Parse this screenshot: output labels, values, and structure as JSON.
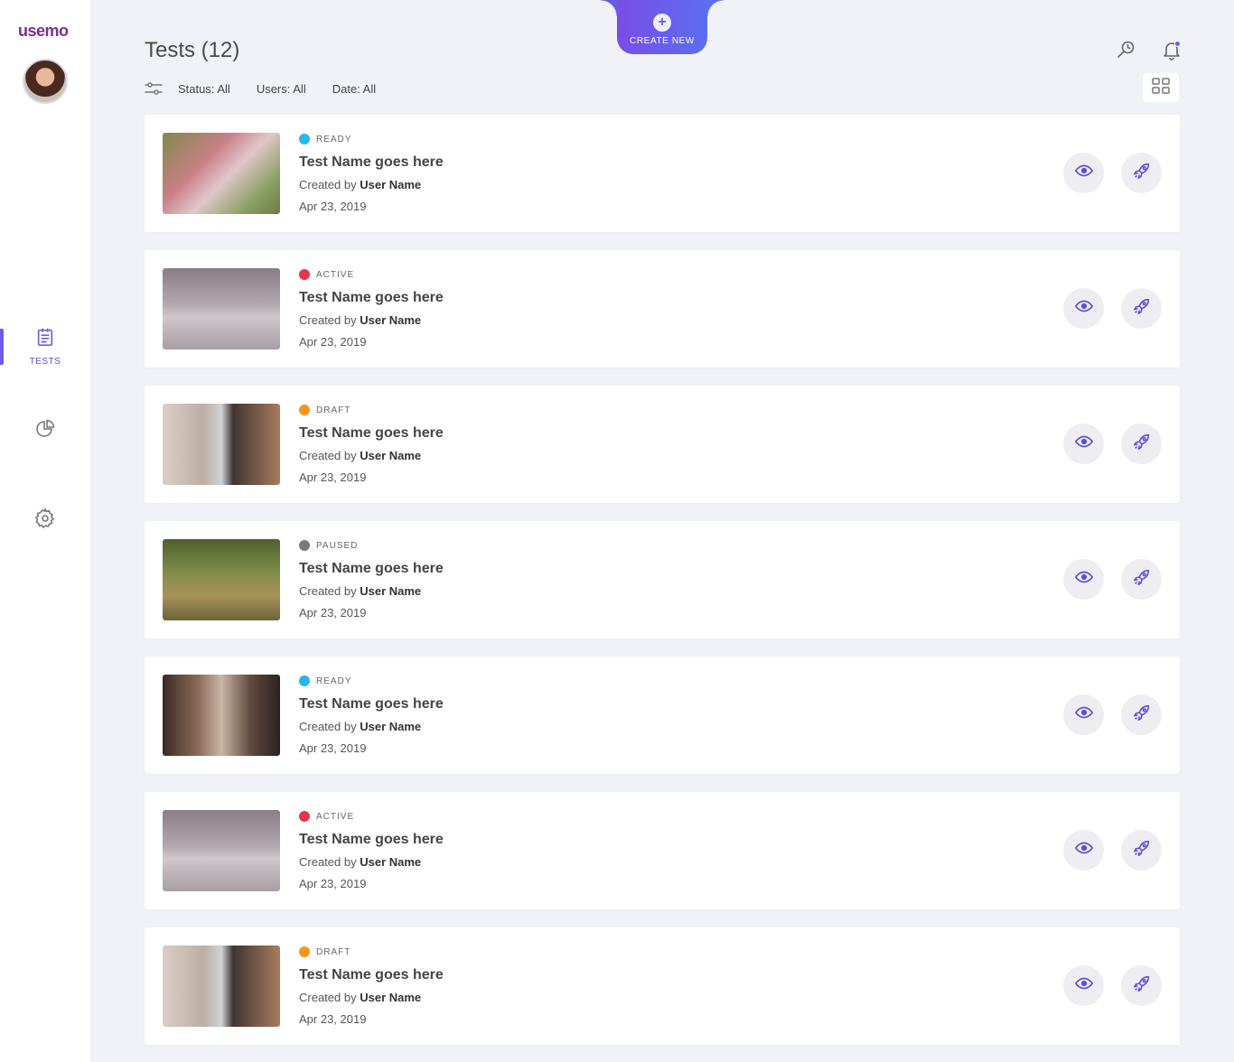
{
  "app": {
    "logo": "usemo"
  },
  "sidebar": {
    "items": [
      {
        "label": "TESTS",
        "icon": "clipboard-icon",
        "active": true
      },
      {
        "label": "",
        "icon": "pie-chart-icon",
        "active": false
      },
      {
        "label": "",
        "icon": "gear-icon",
        "active": false
      }
    ]
  },
  "header": {
    "title": "Tests (12)",
    "create_label": "CREATE NEW"
  },
  "filters": {
    "status": "Status: All",
    "users": "Users: All",
    "date": "Date: All"
  },
  "colors": {
    "accent": "#6c5ce7",
    "ready": "#29b6e8",
    "active": "#e8344e",
    "draft": "#f7941d",
    "paused": "#7a7a7a"
  },
  "tests": [
    {
      "status": "READY",
      "name": "Test Name goes here",
      "created_prefix": "Created by",
      "user": "User Name",
      "date": "Apr 23, 2019"
    },
    {
      "status": "ACTIVE",
      "name": "Test Name goes here",
      "created_prefix": "Created by",
      "user": "User Name",
      "date": "Apr 23, 2019"
    },
    {
      "status": "DRAFT",
      "name": "Test Name goes here",
      "created_prefix": "Created by",
      "user": "User Name",
      "date": "Apr 23, 2019"
    },
    {
      "status": "PAUSED",
      "name": "Test Name goes here",
      "created_prefix": "Created by",
      "user": "User Name",
      "date": "Apr 23, 2019"
    },
    {
      "status": "READY",
      "name": "Test Name goes here",
      "created_prefix": "Created by",
      "user": "User Name",
      "date": "Apr 23, 2019"
    },
    {
      "status": "ACTIVE",
      "name": "Test Name goes here",
      "created_prefix": "Created by",
      "user": "User Name",
      "date": "Apr 23, 2019"
    },
    {
      "status": "DRAFT",
      "name": "Test Name goes here",
      "created_prefix": "Created by",
      "user": "User Name",
      "date": "Apr 23, 2019"
    }
  ]
}
